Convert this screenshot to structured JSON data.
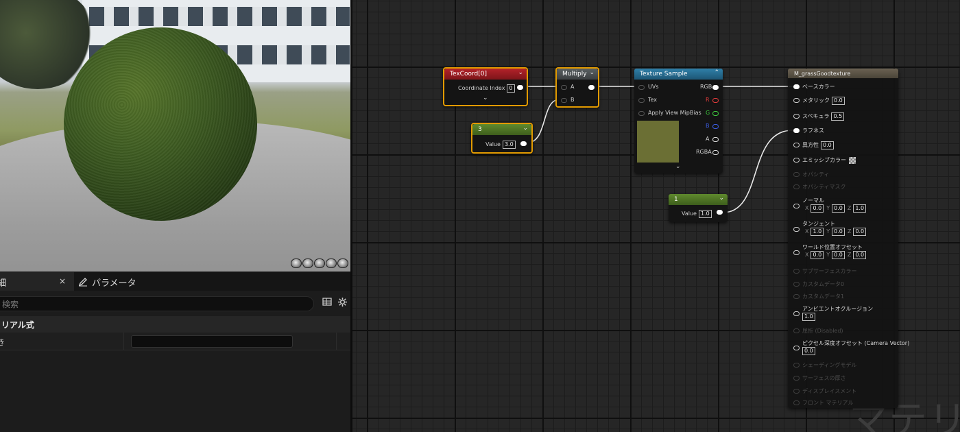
{
  "viewport": {
    "preview_buttons": [
      "cylinder",
      "sphere",
      "plane",
      "cube",
      "teapot"
    ]
  },
  "details": {
    "tab_details_label": "細",
    "tab_close_glyph": "×",
    "tab_params_label": "パラメータ",
    "search_placeholder": "検索",
    "section_label": "リアル式",
    "property_label": "き",
    "property_value": ""
  },
  "graph": {
    "watermark": "マテリアル",
    "texcoord": {
      "title": "TexCoord[0]",
      "index_label": "Coordinate Index",
      "index_value": "0"
    },
    "multiply": {
      "title": "Multiply",
      "pin_a": "A",
      "pin_b": "B"
    },
    "const3": {
      "title": "3",
      "value_label": "Value",
      "value": "3.0"
    },
    "texsample": {
      "title": "Texture Sample",
      "in_uvs": "UVs",
      "in_tex": "Tex",
      "in_mip": "Apply View MipBias",
      "out_rgb": "RGB",
      "out_r": "R",
      "out_g": "G",
      "out_b": "B",
      "out_a": "A",
      "out_rgba": "RGBA",
      "thumb_color": "#6b6f34"
    },
    "const1": {
      "title": "1",
      "value_label": "Value",
      "value": "1.0"
    },
    "material": {
      "title": "M_grassGoodtexture",
      "base_color": "ベースカラー",
      "metallic": "メタリック",
      "metallic_value": "0.0",
      "specular": "スペキュラ",
      "specular_value": "0.5",
      "roughness": "ラフネス",
      "anisotropy": "異方性",
      "anisotropy_value": "0.0",
      "emissive": "エミッシブカラー",
      "opacity": "オパシティ",
      "opacity_mask": "オパシティマスク",
      "normal": "ノーマル",
      "normal_x": "0.0",
      "normal_y": "0.0",
      "normal_z": "1.0",
      "tangent": "タンジェント",
      "tangent_x": "1.0",
      "tangent_y": "0.0",
      "tangent_z": "0.0",
      "wpo": "ワールド位置オフセット",
      "wpo_x": "0.0",
      "wpo_y": "0.0",
      "wpo_z": "0.0",
      "subsurface": "サブサーフェスカラー",
      "custom0": "カスタムデータ0",
      "custom1": "カスタムデータ1",
      "ao": "アンビエントオクルージョン",
      "ao_value": "1.0",
      "refraction": "屈折 (Disabled)",
      "pdo": "ピクセル深度オフセット (Camera Vector)",
      "pdo_value": "0.0",
      "shading_model": "シェーディングモデル",
      "surface_thickness": "サーフェスの厚さ",
      "displacement": "ディスプレイスメント",
      "front_material": "フロント マテリアル",
      "axis_x": "X",
      "axis_y": "Y",
      "axis_z": "Z"
    }
  }
}
